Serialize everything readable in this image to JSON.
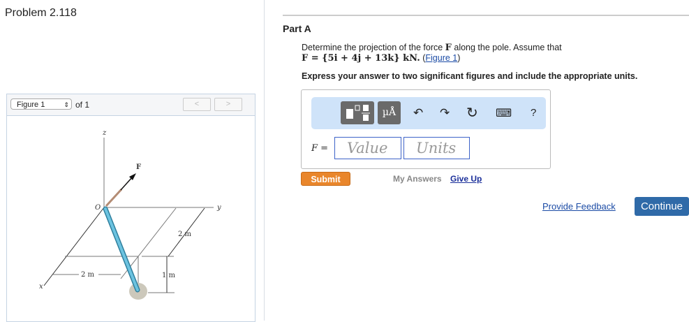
{
  "problem_title": "Problem 2.118",
  "figure_panel": {
    "selector_value": "Figure 1",
    "of_label": "of 1",
    "prev": "<",
    "next": ">",
    "labels": {
      "z": "z",
      "y": "y",
      "x": "x",
      "O": "O",
      "F": "F",
      "dim_2m_a": "2 m",
      "dim_2m_b": "2 m",
      "dim_1m": "1 m"
    }
  },
  "part": {
    "title": "Part A",
    "question_text": "Determine the projection of the force ",
    "question_bold": "F",
    "question_text2": " along the pole. Assume that",
    "equation": "F = {5i + 4j + 13k} kN.",
    "figure_link": "Figure 1",
    "instruction": "Express your answer to two significant figures and include the appropriate units."
  },
  "toolbar": {
    "units_button": "µÅ",
    "undo": "↶",
    "redo": "↷",
    "reset": "↻",
    "keyboard": "⌨",
    "help": "?"
  },
  "answer": {
    "label": "F =",
    "value_placeholder": "Value",
    "units_placeholder": "Units"
  },
  "actions": {
    "submit": "Submit",
    "my_answers": "My Answers",
    "give_up": "Give Up",
    "feedback": "Provide Feedback",
    "continue": "Continue"
  },
  "colors": {
    "submit": "#e9862b",
    "continue": "#2f6aa8",
    "toolbar": "#cfe3f9",
    "pole": "#4fb0d0"
  }
}
